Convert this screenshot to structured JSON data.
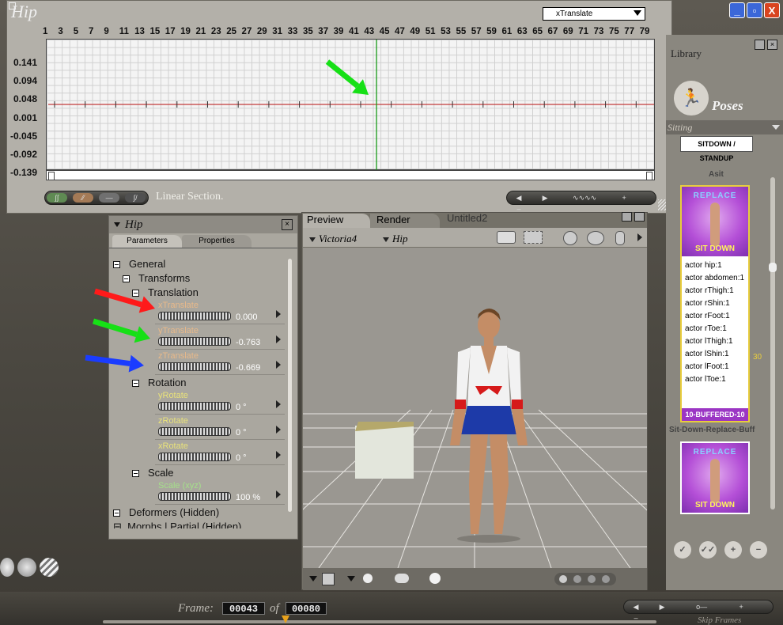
{
  "window_controls": {
    "minimize": "_",
    "restore": "▫",
    "close": "X"
  },
  "graph": {
    "title": "Hip",
    "parameter_select": "xTranslate",
    "frame_ticks": [
      "1",
      "3",
      "5",
      "7",
      "9",
      "11",
      "13",
      "15",
      "17",
      "19",
      "21",
      "23",
      "25",
      "27",
      "29",
      "31",
      "33",
      "35",
      "37",
      "39",
      "41",
      "43",
      "45",
      "47",
      "49",
      "51",
      "53",
      "55",
      "57",
      "59",
      "61",
      "63",
      "65",
      "67",
      "69",
      "71",
      "73",
      "75",
      "77",
      "79"
    ],
    "y_ticks": [
      "0.141",
      "0.094",
      "0.048",
      "0.001",
      "-0.045",
      "-0.092",
      "-0.139"
    ],
    "section_label": "Linear Section.",
    "current_frame_marker": 43
  },
  "parameters_panel": {
    "title": "Hip",
    "tabs": [
      "Parameters",
      "Properties"
    ],
    "groups": {
      "general": "General",
      "transforms": "Transforms",
      "translation": "Translation",
      "rotation": "Rotation",
      "scale": "Scale",
      "deformers": "Deformers (Hidden)",
      "morphs": "Morphs | Partial (Hidden)"
    },
    "params": [
      {
        "label": "xTranslate",
        "value": "0.000"
      },
      {
        "label": "yTranslate",
        "value": "-0.763"
      },
      {
        "label": "zTranslate",
        "value": "-0.669"
      },
      {
        "label": "yRotate",
        "value": "0 °"
      },
      {
        "label": "zRotate",
        "value": "0 °"
      },
      {
        "label": "xRotate",
        "value": "0 °"
      },
      {
        "label": "Scale (xyz)",
        "value": "100 %"
      }
    ]
  },
  "preview": {
    "tabs": [
      "Preview",
      "Render",
      "Untitled2"
    ],
    "figure_select": "Victoria4",
    "actor_select": "Hip"
  },
  "library": {
    "title": "Library",
    "category": "Poses",
    "subfolder": "Sitting",
    "items": [
      {
        "label": "SITDOWN / STANDUP",
        "caption": "Asit"
      },
      {
        "top": "REPLACE",
        "bottom": "SIT DOWN",
        "footer": "10-BUFFERED-10",
        "caption": "Sit-Down-Replace-Buff",
        "actors": [
          "actor hip:1",
          "actor abdomen:1",
          "actor rThigh:1",
          "actor rShin:1",
          "actor rFoot:1",
          "actor rToe:1",
          "actor lThigh:1",
          "actor lShin:1",
          "actor lFoot:1",
          "actor lToe:1"
        ]
      },
      {
        "top": "REPLACE",
        "bottom": "SIT DOWN"
      }
    ],
    "side_number": "30"
  },
  "timeline": {
    "frame_label": "Frame:",
    "current_frame": "00043",
    "of_label": "of",
    "total_frames": "00080",
    "skip_frames": "Skip Frames"
  },
  "annotation_arrows": [
    {
      "target": "xTranslate",
      "color": "#ff1a1a"
    },
    {
      "target": "yTranslate",
      "color": "#16e016"
    },
    {
      "target": "zTranslate",
      "color": "#1a3cff"
    },
    {
      "target": "graph-current-frame",
      "color": "#16e016"
    }
  ]
}
